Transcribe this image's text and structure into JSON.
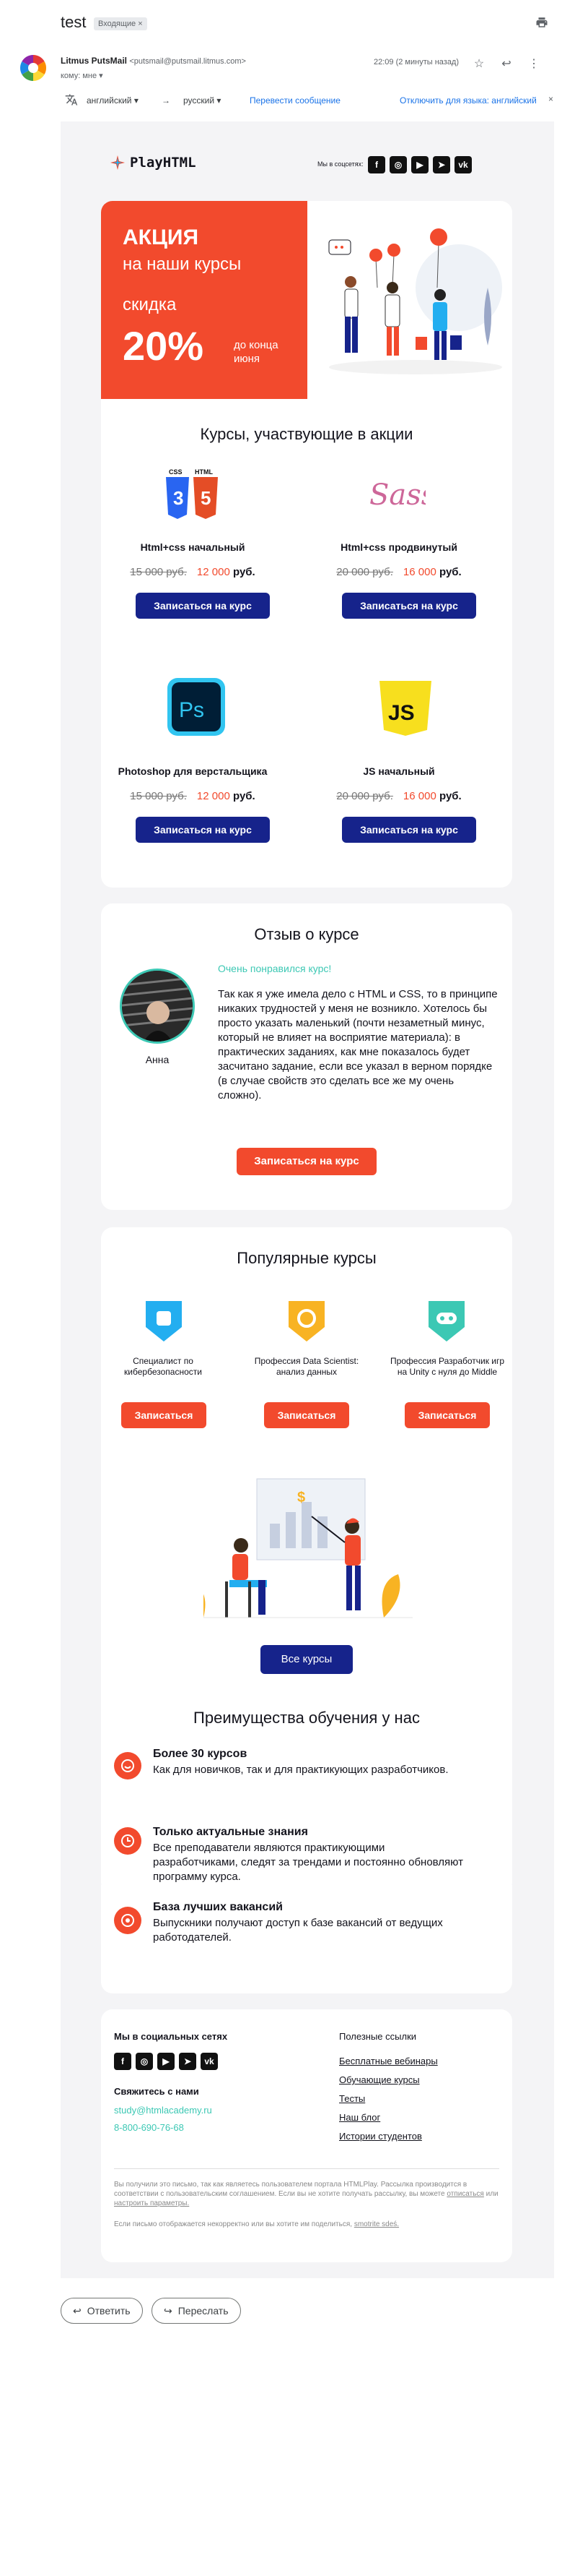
{
  "gmail": {
    "subject": "test",
    "label": "Входящие ×",
    "sender_name": "Litmus PutsMail",
    "sender_email": "<putsmail@putsmail.litmus.com>",
    "to": "кому: мне ▾",
    "time": "22:09 (2 минуты назад)",
    "translate": {
      "from": "английский",
      "to": "русский",
      "action": "Перевести сообщение",
      "disable": "Отключить для языка: английский"
    },
    "reply": "Ответить",
    "forward": "Переслать"
  },
  "email": {
    "logo": "PlayHTML",
    "social_label": "Мы в соцсетях:",
    "social_icons": [
      "facebook-icon",
      "instagram-icon",
      "youtube-icon",
      "telegram-icon",
      "vk-icon"
    ],
    "promo": {
      "line1": "АКЦИЯ",
      "line2": "на наши курсы",
      "line3": "скидка",
      "percent": "20%",
      "until1": "до конца",
      "until2": "июня",
      "bg_color": "#f24a2d"
    },
    "courses": {
      "heading": "Курсы, участвующие в акции",
      "currency": "руб.",
      "button": "Записаться на курс",
      "items": [
        {
          "title": "Html+css начальный",
          "old": "15 000 руб.",
          "new": "12 000",
          "icon": "html-css-icon"
        },
        {
          "title": "Html+css продвинутый",
          "old": "20 000 руб.",
          "new": "16 000",
          "icon": "sass-icon"
        },
        {
          "title": "Photoshop для верстальщика",
          "old": "15 000 руб.",
          "new": "12 000",
          "icon": "photoshop-icon"
        },
        {
          "title": "JS начальный",
          "old": "20 000 руб.",
          "new": "16 000",
          "icon": "js-icon"
        }
      ]
    },
    "review": {
      "heading": "Отзыв о курсе",
      "name": "Анна",
      "lead": "Очень понравился курс!",
      "text": "Так как я уже имела дело с HTML и CSS, то в принципе никаких трудностей у меня не возникло. Хотелось бы просто указать маленький (почти незаметный минус, который не влияет на восприятие материала): в практических заданиях, как мне показалось будет засчитано задание, если все указал в верном порядке (в случае свойств это сделать все же му очень сложно).",
      "button": "Записаться на курс"
    },
    "popular": {
      "heading": "Популярные курсы",
      "button": "Записаться",
      "all_button": "Все курсы",
      "items": [
        {
          "title": "Специалист по кибербезопасности",
          "color": "#23aef0"
        },
        {
          "title": "Профессия Data Scientist: анализ данных",
          "color": "#f8b323"
        },
        {
          "title": "Профессия Разработчик игр на Unity с нуля до Middle",
          "color": "#3cc8b4"
        }
      ]
    },
    "advantages": {
      "heading": "Преимущества обучения у нас",
      "items": [
        {
          "title": "Более 30 курсов",
          "text": "Как для новичков, так и для практикующих разработчиков."
        },
        {
          "title": "Только актуальные знания",
          "text": "Все преподаватели являются практикующими разработчиками, следят за трендами и постоянно обновляют программу курса."
        },
        {
          "title": "База лучших вакансий",
          "text": "Выпускники получают доступ к базе вакансий от ведущих работодателей."
        }
      ]
    },
    "footer": {
      "social_heading": "Мы в социальных сетях",
      "contact_heading": "Свяжитесь с нами",
      "email": "study@htmlacademy.ru",
      "phone": "8-800-690-76-68",
      "links_heading": "Полезные ссылки",
      "links": [
        "Бесплатные вебинары",
        "Обучающие курсы",
        "Тесты",
        "Наш блог",
        "Истории студентов"
      ],
      "legal1": "Вы получили это письмо, так как являетесь пользователем портала HTMLPlay. Рассылка производится в соответствии с пользовательским соглашением. Если вы не хотите получать рассылку, вы можете",
      "unsubscribe": "отписаться",
      "legal_or": "или",
      "settings": "настроить параметры.",
      "legal2": "Если письмо отображается некорректно или вы хотите им поделиться,",
      "view_web": "smotrite sdeś."
    }
  }
}
